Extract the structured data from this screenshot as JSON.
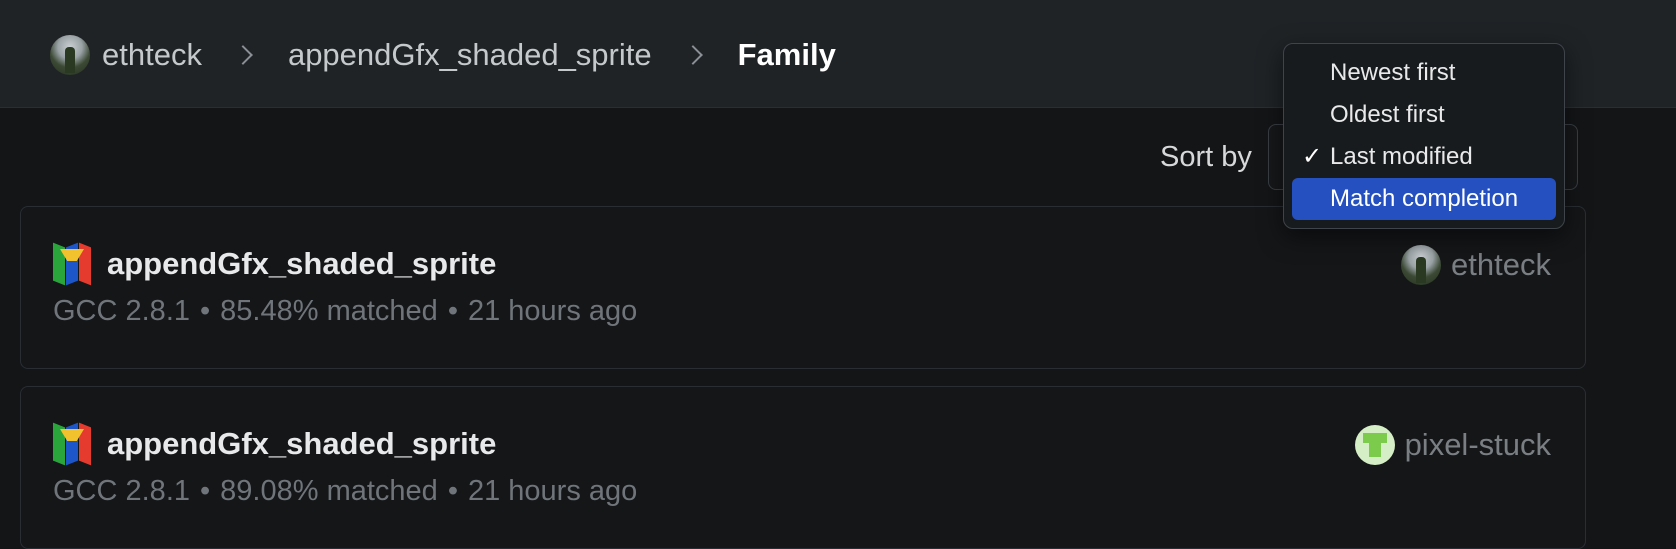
{
  "breadcrumb": {
    "user": "ethteck",
    "scratch": "appendGfx_shaded_sprite",
    "current": "Family"
  },
  "sort": {
    "label": "Sort by",
    "options": [
      "Newest first",
      "Oldest first",
      "Last modified",
      "Match completion"
    ],
    "checked": "Last modified",
    "highlighted": "Match completion",
    "check_glyph": "✓"
  },
  "cards": [
    {
      "title": "appendGfx_shaded_sprite",
      "platform_icon": "n64-icon",
      "compiler": "GCC 2.8.1",
      "match": "85.48% matched",
      "time": "21 hours ago",
      "owner": "ethteck"
    },
    {
      "title": "appendGfx_shaded_sprite",
      "platform_icon": "n64-icon",
      "compiler": "GCC 2.8.1",
      "match": "89.08% matched",
      "time": "21 hours ago",
      "owner": "pixel-stuck"
    }
  ],
  "separator": "•",
  "colors": {
    "background": "#131517",
    "topbar": "#1f2326",
    "highlight": "#2550c0"
  }
}
